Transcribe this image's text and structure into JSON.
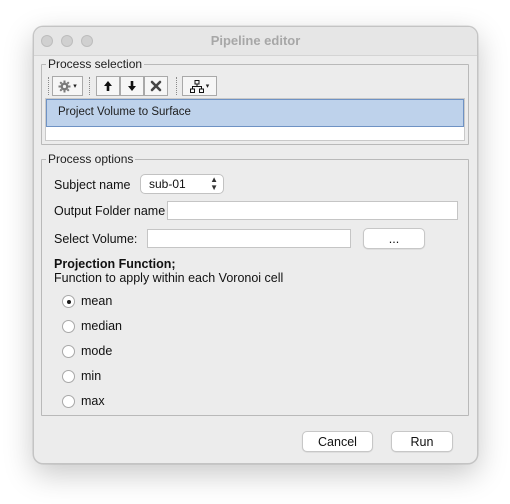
{
  "window": {
    "title": "Pipeline editor"
  },
  "process_selection": {
    "legend": "Process selection",
    "toolbar": {
      "gear_icon": "gear-icon",
      "up_label": "🡅",
      "down_label": "🡇",
      "remove_label": "✕",
      "tree_icon": "hierarchy-icon"
    },
    "items": [
      "Project Volume to Surface"
    ]
  },
  "process_options": {
    "legend": "Process options",
    "subject_name": {
      "label": "Subject name",
      "value": "sub-01"
    },
    "output_folder": {
      "label": "Output Folder name",
      "value": ""
    },
    "select_volume": {
      "label": "Select Volume:",
      "value": "",
      "browse_label": "..."
    },
    "projection": {
      "title": "Projection Function;",
      "subtitle": "Function to apply within each Voronoi cell",
      "selected": "mean",
      "options": [
        "mean",
        "median",
        "mode",
        "min",
        "max"
      ]
    }
  },
  "buttons": {
    "cancel": "Cancel",
    "run": "Run"
  }
}
